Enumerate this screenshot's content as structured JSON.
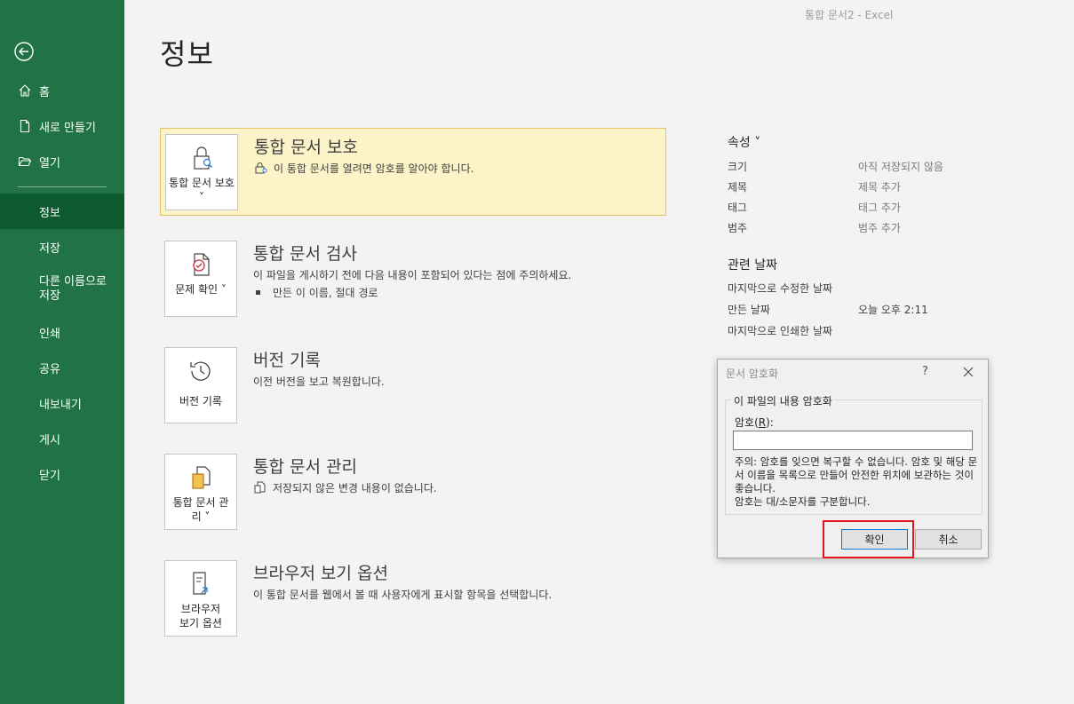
{
  "window": {
    "title": "통합 문서2  -  Excel"
  },
  "sidebar": {
    "items": [
      {
        "label": "홈"
      },
      {
        "label": "새로 만들기"
      },
      {
        "label": "열기"
      },
      {
        "label": "정보"
      },
      {
        "label": "저장"
      },
      {
        "label": "다른 이름으로 저장"
      },
      {
        "label": "인쇄"
      },
      {
        "label": "공유"
      },
      {
        "label": "내보내기"
      },
      {
        "label": "게시"
      },
      {
        "label": "닫기"
      }
    ]
  },
  "page": {
    "title": "정보"
  },
  "sections": [
    {
      "tile": "통합 문서 보호",
      "title": "통합 문서 보호",
      "desc": "이 통합 문서를 열려면 암호를 알아야 합니다."
    },
    {
      "tile": "문제 확인",
      "title": "통합 문서 검사",
      "desc": "이 파일을 게시하기 전에 다음 내용이 포함되어 있다는 점에 주의하세요.",
      "bullet": "만든 이 이름, 절대 경로"
    },
    {
      "tile": "버전 기록",
      "title": "버전 기록",
      "desc": "이전 버전을 보고 복원합니다."
    },
    {
      "tile": "통합 문서 관리",
      "title": "통합 문서 관리",
      "desc": "저장되지 않은 변경 내용이 없습니다."
    },
    {
      "tile": "브라우저 보기 옵션",
      "title": "브라우저 보기 옵션",
      "desc": "이 통합 문서를 웹에서 볼 때 사용자에게 표시할 항목을 선택합니다."
    }
  ],
  "properties": {
    "header": "속성",
    "rows": [
      {
        "key": "크기",
        "value": "아직 저장되지 않음"
      },
      {
        "key": "제목",
        "value": "제목 추가"
      },
      {
        "key": "태그",
        "value": "태그 추가"
      },
      {
        "key": "범주",
        "value": "범주 추가"
      }
    ]
  },
  "dates": {
    "header": "관련 날짜",
    "rows": [
      {
        "key": "마지막으로 수정한 날짜",
        "value": ""
      },
      {
        "key": "만든 날짜",
        "value": "오늘 오후 2:11"
      },
      {
        "key": "마지막으로 인쇄한 날짜",
        "value": ""
      }
    ]
  },
  "dialog": {
    "title": "문서 암호화",
    "help": "?",
    "group_label": "이 파일의 내용 암호화",
    "password_label_prefix": "암호(",
    "password_label_key": "R",
    "password_label_suffix": "):",
    "password_value": "",
    "note": "주의: 암호를 잊으면 복구할 수 없습니다. 암호 및 해당 문서 이름을 목록으로 만들어 안전한 위치에 보관하는 것이 좋습니다.\n암호는 대/소문자를 구분합니다.",
    "ok_label": "확인",
    "cancel_label": "취소"
  }
}
